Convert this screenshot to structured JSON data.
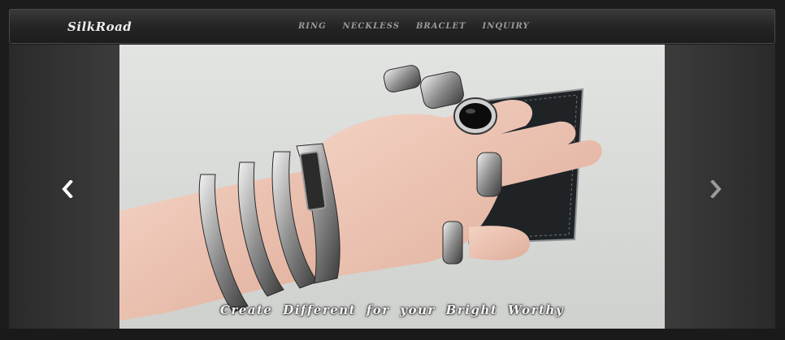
{
  "navbar": {
    "brand": "SilkRoad",
    "links": [
      "RING",
      "NECKLESS",
      "BRACLET",
      "INQUIRY"
    ]
  },
  "carousel": {
    "caption": "Create Different for your Bright Worthy",
    "image_description": "Hand wearing several silver rings and silver chain bracelets, holding a black leather wallet",
    "prev_icon": "chevron-left-icon",
    "next_icon": "chevron-right-icon"
  },
  "colors": {
    "navbar_bg": "#232323",
    "page_bg": "#1c1c1c",
    "brand_text": "#ececec",
    "nav_text": "#9a9a9a",
    "caption_text": "#f4f4f4"
  }
}
